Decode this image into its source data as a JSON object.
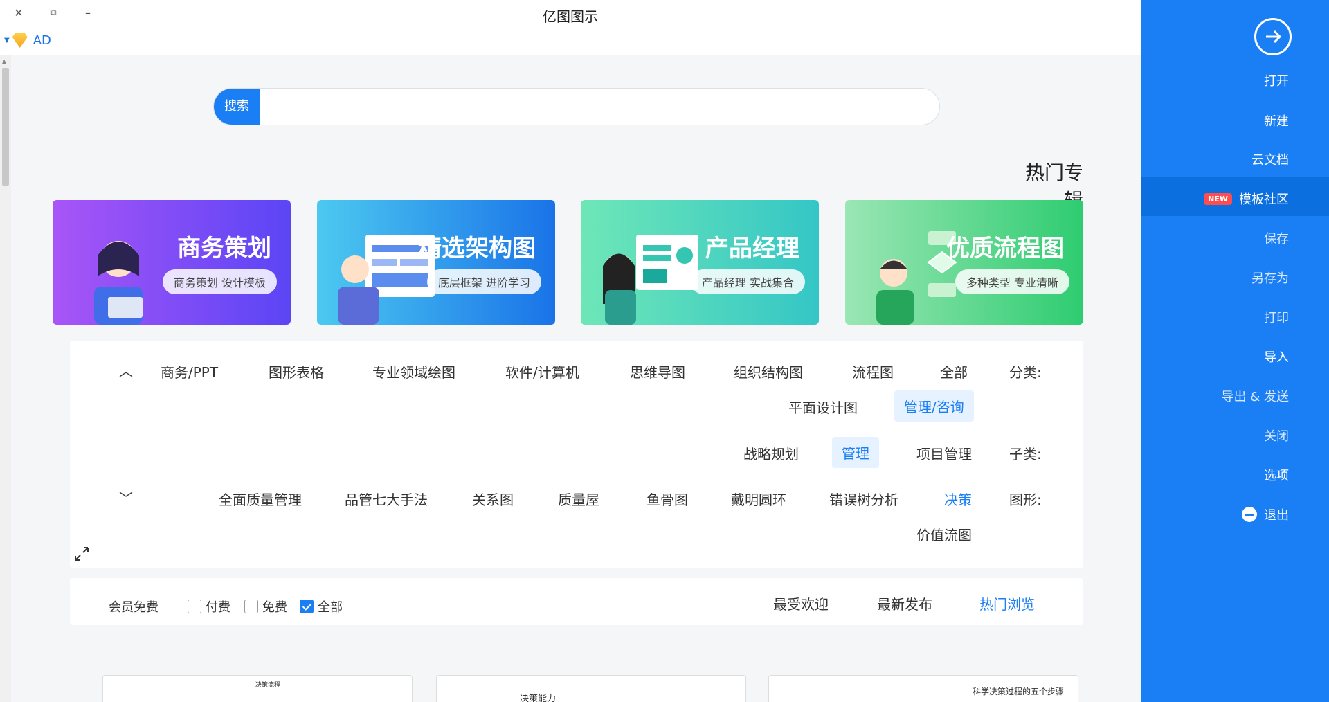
{
  "window": {
    "title": "亿图图示",
    "close_glyph": "✕",
    "restore_glyph": "⧉",
    "minimize_glyph": "–"
  },
  "account": {
    "label": "AD"
  },
  "search": {
    "button_label": "搜索",
    "placeholder": ""
  },
  "hot_section": {
    "title": "热门专辑"
  },
  "banners": [
    {
      "title": "商务策划",
      "subtitle": "商务策划 设计模板",
      "color": "#7c4dff"
    },
    {
      "title": "精选架构图",
      "subtitle": "底层框架 进阶学习",
      "color": "#1a8cf0"
    },
    {
      "title": "产品经理",
      "subtitle": "产品经理 实战集合",
      "color": "#34c6b0"
    },
    {
      "title": "优质流程图",
      "subtitle": "多种类型 专业清晰",
      "color": "#2ecc71"
    }
  ],
  "filters": {
    "category_label": "分类:",
    "categories": [
      "全部",
      "流程图",
      "组织结构图",
      "思维导图",
      "软件/计算机",
      "专业领域绘图",
      "图形表格",
      "商务/PPT",
      "管理/咨询",
      "平面设计图"
    ],
    "subcategory_label": "子类:",
    "subcategories": [
      "项目管理",
      "管理",
      "战略规划"
    ],
    "shape_label": "图形:",
    "shapes": [
      "决策",
      "错误树分析",
      "戴明圆环",
      "鱼骨图",
      "质量屋",
      "关系图",
      "品管七大手法",
      "全面质量管理",
      "价值流图"
    ]
  },
  "sort": {
    "tabs": [
      "热门浏览",
      "最新发布",
      "最受欢迎"
    ],
    "checks": [
      {
        "label": "全部",
        "checked": true
      },
      {
        "label": "免费",
        "checked": false
      },
      {
        "label": "付费",
        "checked": false
      },
      {
        "label": "会员免费",
        "checked": false
      }
    ]
  },
  "cards": [
    {
      "title": "科学决策过程的五个步骤"
    },
    {
      "title": "决策能力"
    },
    {
      "title": "决策流程"
    }
  ],
  "sidebar": {
    "items": [
      {
        "label": "打开"
      },
      {
        "label": "新建"
      },
      {
        "label": "云文档"
      },
      {
        "label": "模板社区",
        "badge": "NEW"
      },
      {
        "label": "保存"
      },
      {
        "label": "另存为"
      },
      {
        "label": "打印"
      },
      {
        "label": "导入"
      },
      {
        "label": "导出 & 发送"
      },
      {
        "label": "关闭"
      },
      {
        "label": "选项"
      },
      {
        "label": "退出"
      }
    ]
  },
  "colors": {
    "accent": "#1a7ef5",
    "sidebar": "#1a7ef5",
    "badge": "#ff4d4f"
  }
}
